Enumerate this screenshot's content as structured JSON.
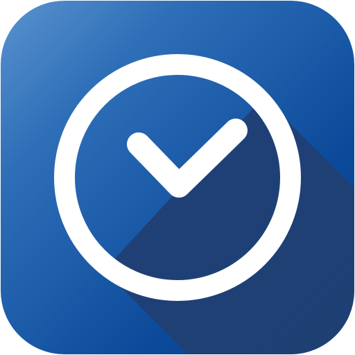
{
  "app_icon": {
    "icon_name": "checkmark-circle-icon",
    "colors": {
      "background_light": "#2f6fb8",
      "background_dark": "#0b4a9a",
      "long_shadow": "#1e3f78",
      "foreground": "#ffffff"
    }
  }
}
